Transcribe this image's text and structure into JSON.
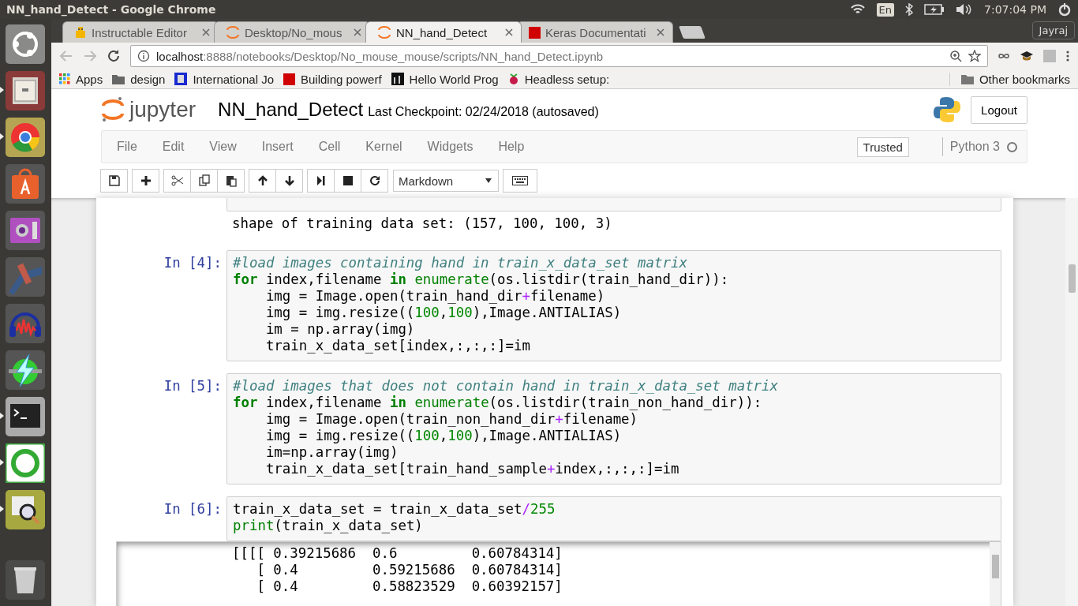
{
  "window": {
    "title": "NN_hand_Detect - Google Chrome"
  },
  "system_tray": {
    "language": "En",
    "clock": "7:07:04 PM"
  },
  "launcher": [
    {
      "kind": "ubuntu",
      "running": false
    },
    {
      "kind": "files",
      "running": true
    },
    {
      "kind": "browser",
      "running": true
    },
    {
      "kind": "store",
      "running": false
    },
    {
      "kind": "camera",
      "running": false
    },
    {
      "kind": "satellite",
      "running": false
    },
    {
      "kind": "audio",
      "running": false
    },
    {
      "kind": "bolt",
      "running": false
    },
    {
      "kind": "terminal",
      "running": true
    },
    {
      "kind": "ring",
      "running": true
    },
    {
      "kind": "viewer",
      "running": true
    },
    {
      "kind": "trash",
      "running": false
    }
  ],
  "tabs": [
    {
      "label": "Instructable Editor",
      "kind": "robot",
      "selected": false
    },
    {
      "label": "Desktop/No_mous",
      "kind": "jupyter",
      "selected": false
    },
    {
      "label": "NN_hand_Detect",
      "kind": "jupyter",
      "selected": true
    },
    {
      "label": "Keras Documentati",
      "kind": "k",
      "selected": false
    }
  ],
  "profile_button": "Jayraj",
  "address_bar": {
    "host": "localhost",
    "path": ":8888/notebooks/Desktop/No_mouse_mouse/scripts/NN_hand_Detect.ipynb"
  },
  "bookmarks": [
    {
      "label": "Apps",
      "kind": "apps"
    },
    {
      "label": "design",
      "kind": "folder"
    },
    {
      "label": "International Jo",
      "kind": "crest"
    },
    {
      "label": "Building powerf",
      "kind": "k"
    },
    {
      "label": "Hello World Prog",
      "kind": "dark"
    },
    {
      "label": "Headless setup:",
      "kind": "berry"
    }
  ],
  "other_bookmarks": "Other bookmarks",
  "jupyter": {
    "logo_text": "jupyter",
    "notebook_name": "NN_hand_Detect",
    "checkpoint": "Last Checkpoint: 02/24/2018 (autosaved)",
    "logout": "Logout",
    "menu": [
      "File",
      "Edit",
      "View",
      "Insert",
      "Cell",
      "Kernel",
      "Widgets",
      "Help"
    ],
    "trusted": "Trusted",
    "kernel": "Python 3",
    "kernel_busy": false,
    "cell_type": "Markdown"
  },
  "cells": [
    {
      "kind": "cut_off",
      "output": [
        "shape of training data set: (157, 100, 100, 3)"
      ]
    },
    {
      "prompt": "In [4]:",
      "lines": [
        [
          {
            "kind": "comment",
            "text": "#load images containing hand in train_x_data_set matrix"
          }
        ],
        [
          {
            "kind": "keyword",
            "text": "for"
          },
          {
            "kind": "plain",
            "text": " index,filename "
          },
          {
            "kind": "keyword",
            "text": "in"
          },
          {
            "kind": "builtin",
            "text": " enumerate"
          },
          {
            "kind": "plain",
            "text": "(os.listdir(train_hand_dir)):"
          }
        ],
        [
          {
            "kind": "plain",
            "text": "    img = Image.open(train_hand_dir"
          },
          {
            "kind": "operator",
            "text": "+"
          },
          {
            "kind": "plain",
            "text": "filename)"
          }
        ],
        [
          {
            "kind": "plain",
            "text": "    img = img.resize(("
          },
          {
            "kind": "number",
            "text": "100"
          },
          {
            "kind": "plain",
            "text": ","
          },
          {
            "kind": "number",
            "text": "100"
          },
          {
            "kind": "plain",
            "text": "),Image.ANTIALIAS)"
          }
        ],
        [
          {
            "kind": "plain",
            "text": "    im = np.array(img)"
          }
        ],
        [
          {
            "kind": "plain",
            "text": "    train_x_data_set[index,:,:,:]=im"
          }
        ]
      ]
    },
    {
      "prompt": "In [5]:",
      "lines": [
        [
          {
            "kind": "comment",
            "text": "#load images that does not contain hand in train_x_data_set matrix"
          }
        ],
        [
          {
            "kind": "keyword",
            "text": "for"
          },
          {
            "kind": "plain",
            "text": " index,filename "
          },
          {
            "kind": "keyword",
            "text": "in"
          },
          {
            "kind": "builtin",
            "text": " enumerate"
          },
          {
            "kind": "plain",
            "text": "(os.listdir(train_non_hand_dir)):"
          }
        ],
        [
          {
            "kind": "plain",
            "text": "    img = Image.open(train_non_hand_dir"
          },
          {
            "kind": "operator",
            "text": "+"
          },
          {
            "kind": "plain",
            "text": "filename)"
          }
        ],
        [
          {
            "kind": "plain",
            "text": "    img = img.resize(("
          },
          {
            "kind": "number",
            "text": "100"
          },
          {
            "kind": "plain",
            "text": ","
          },
          {
            "kind": "number",
            "text": "100"
          },
          {
            "kind": "plain",
            "text": "),Image.ANTIALIAS)"
          }
        ],
        [
          {
            "kind": "plain",
            "text": "    im=np.array(img)"
          }
        ],
        [
          {
            "kind": "plain",
            "text": "    train_x_data_set[train_hand_sample"
          },
          {
            "kind": "operator",
            "text": "+"
          },
          {
            "kind": "plain",
            "text": "index,:,:,:]=im"
          }
        ]
      ]
    },
    {
      "prompt": "In [6]:",
      "lines": [
        [
          {
            "kind": "plain",
            "text": "train_x_data_set = train_x_data_set"
          },
          {
            "kind": "operator",
            "text": "/"
          },
          {
            "kind": "number",
            "text": "255"
          }
        ],
        [
          {
            "kind": "builtin",
            "text": "print"
          },
          {
            "kind": "plain",
            "text": "(train_x_data_set)"
          }
        ]
      ]
    }
  ],
  "scrolled_output": [
    "[[[[ 0.39215686  0.6         0.60784314]",
    "   [ 0.4         0.59215686  0.60784314]",
    "   [ 0.4         0.58823529  0.60392157]"
  ]
}
